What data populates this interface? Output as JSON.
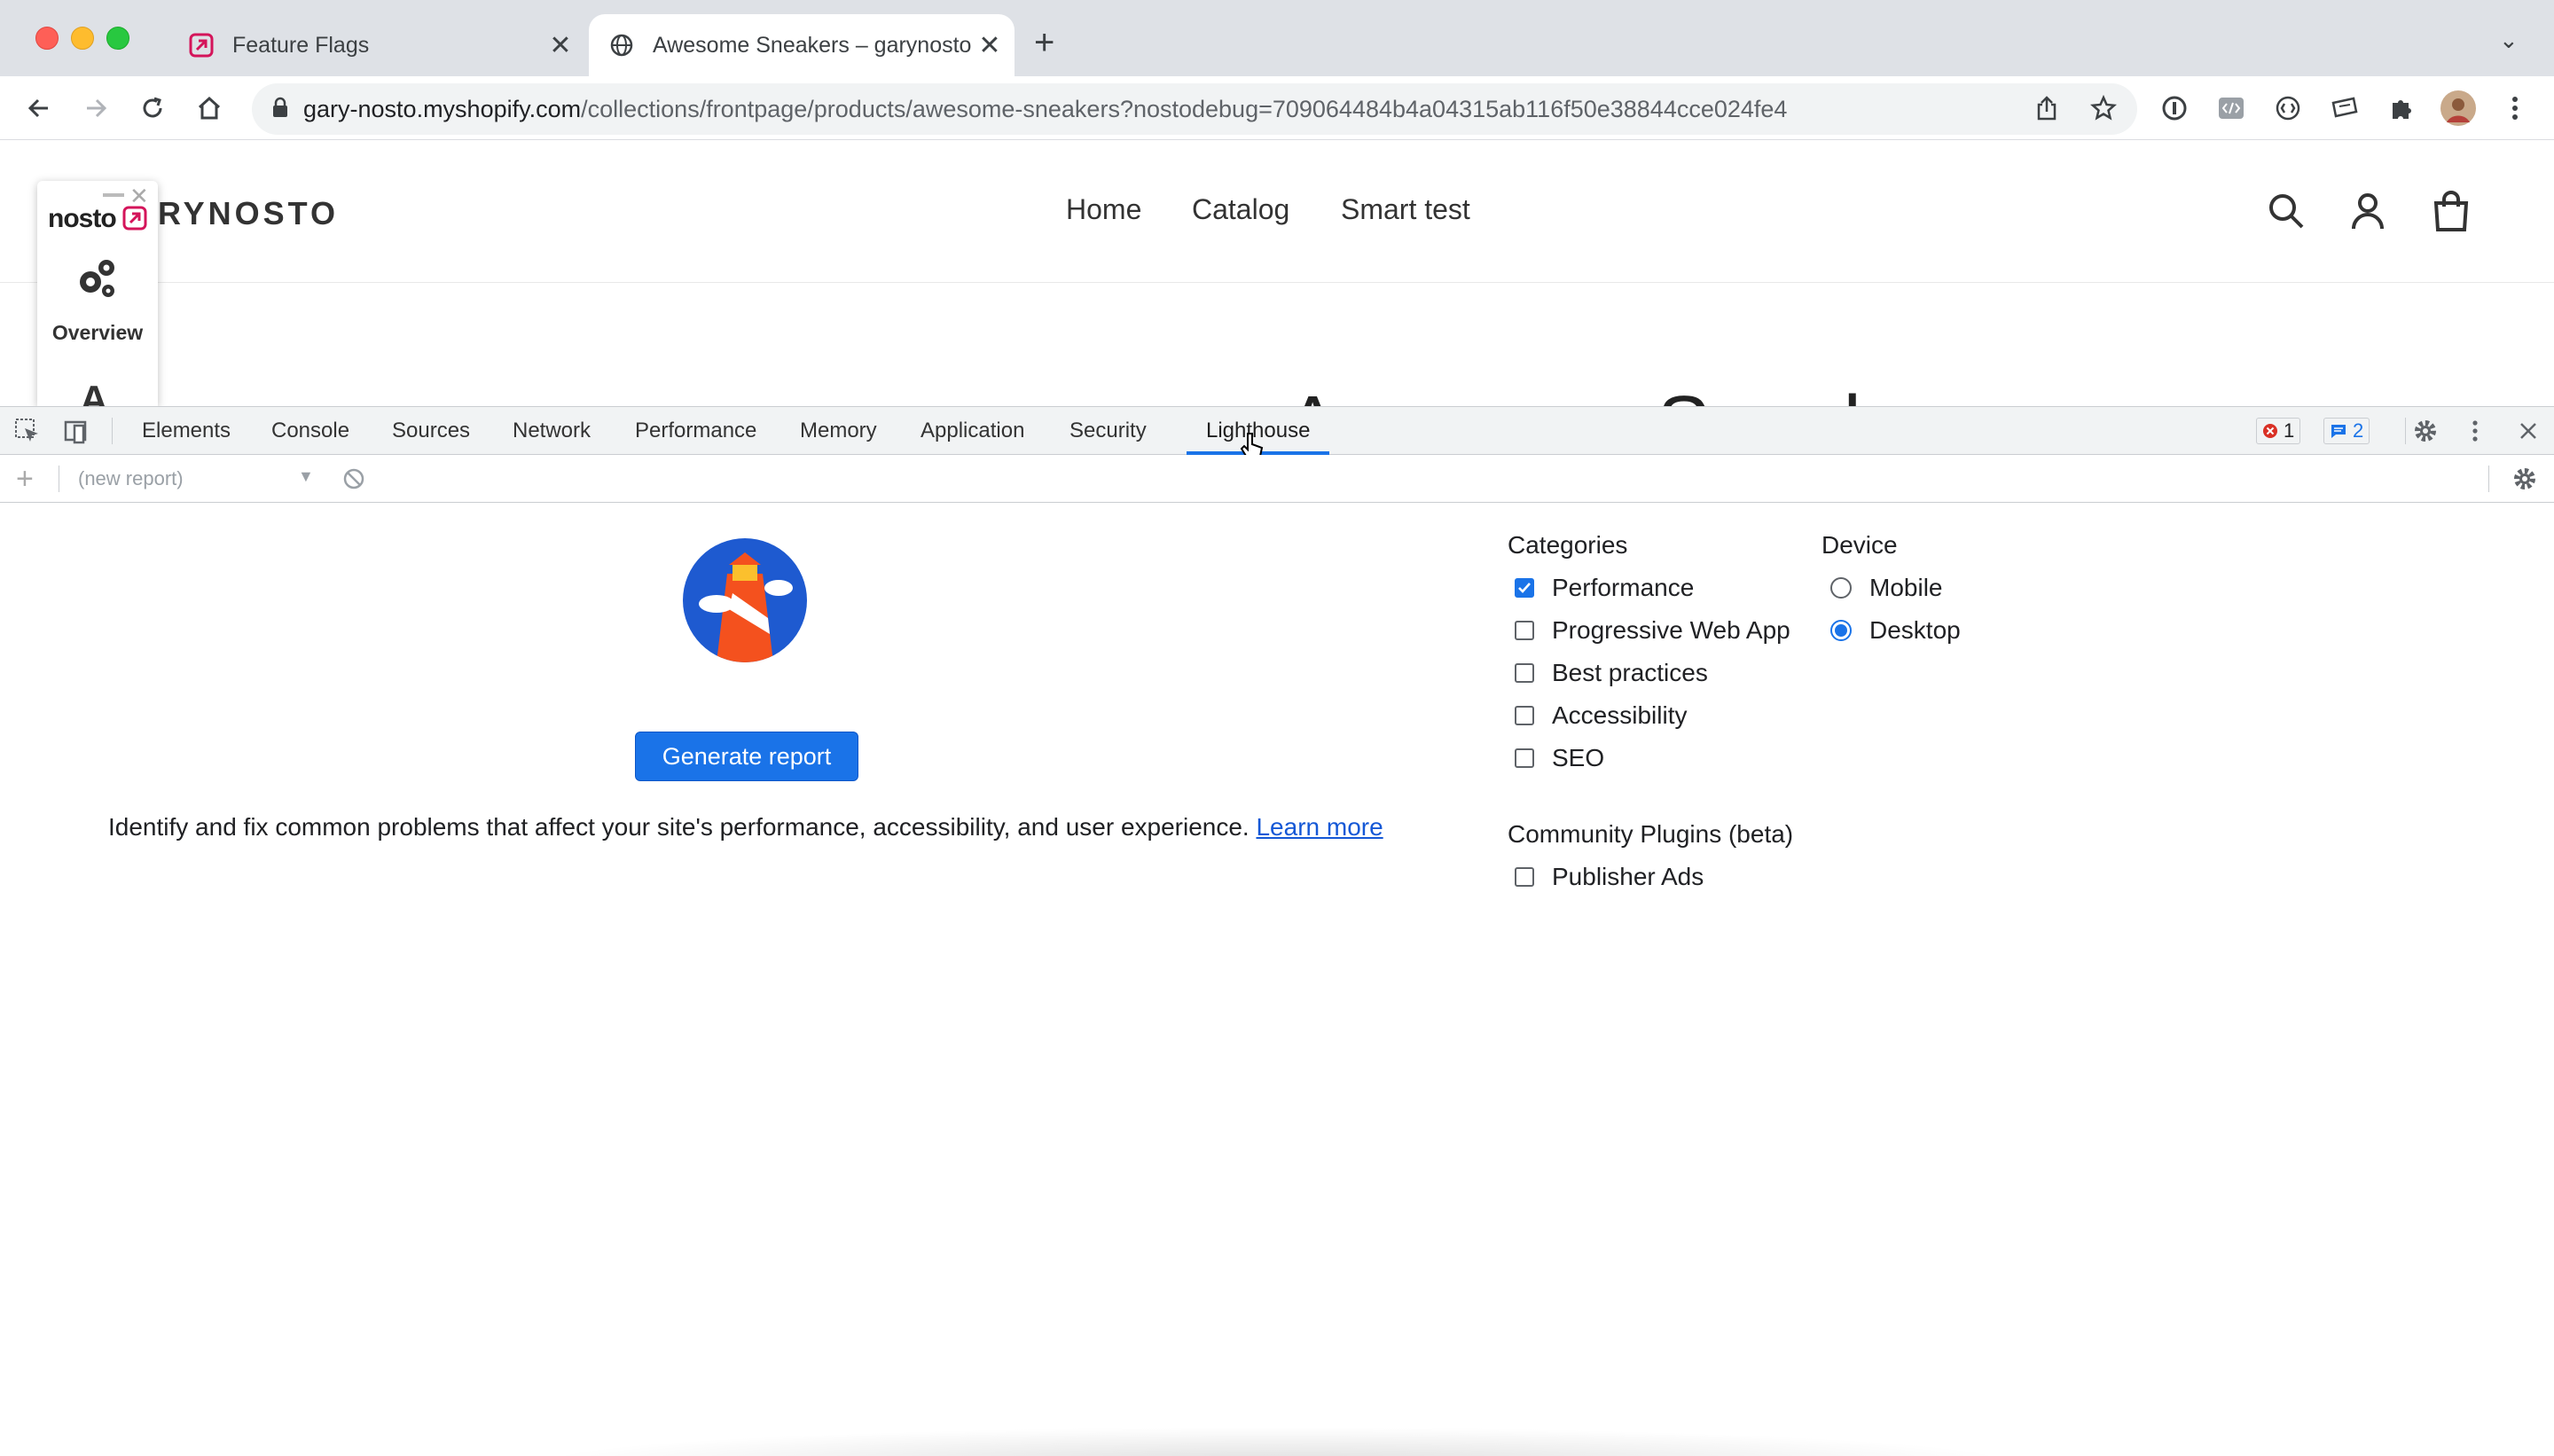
{
  "browser": {
    "tabs": [
      {
        "title": "Feature Flags",
        "favicon": "nosto-icon"
      },
      {
        "title": "Awesome Sneakers – garynosto",
        "favicon": "globe-icon"
      }
    ],
    "url_host": "gary-nosto.myshopify.com",
    "url_path": "/collections/frontpage/products/awesome-sneakers?nostodebug=709064484b4a04315ab116f50e38844cce024fe4"
  },
  "shop": {
    "logo": "RYNOSTO",
    "nav": [
      "Home",
      "Catalog",
      "Smart test"
    ],
    "product_title": "Awesome Sneakers"
  },
  "nosto": {
    "logo": "nosto",
    "overview_label": "Overview",
    "next_letter": "A"
  },
  "devtools": {
    "tabs": [
      "Elements",
      "Console",
      "Sources",
      "Network",
      "Performance",
      "Memory",
      "Application",
      "Security",
      "Lighthouse"
    ],
    "active_tab": "Lighthouse",
    "error_count": "1",
    "message_count": "2",
    "report_select": "(new report)"
  },
  "lighthouse": {
    "button": "Generate report",
    "description": "Identify and fix common problems that affect your site's performance, accessibility, and user experience.",
    "learn_more": "Learn more",
    "categories_title": "Categories",
    "categories": [
      {
        "label": "Performance",
        "checked": true
      },
      {
        "label": "Progressive Web App",
        "checked": false
      },
      {
        "label": "Best practices",
        "checked": false
      },
      {
        "label": "Accessibility",
        "checked": false
      },
      {
        "label": "SEO",
        "checked": false
      }
    ],
    "device_title": "Device",
    "devices": [
      {
        "label": "Mobile",
        "selected": false
      },
      {
        "label": "Desktop",
        "selected": true
      }
    ],
    "plugins_title": "Community Plugins (beta)",
    "plugins": [
      {
        "label": "Publisher Ads",
        "checked": false
      }
    ]
  },
  "colors": {
    "accent": "#1a73e8",
    "lighthouse_blue": "#1e5ad0",
    "lighthouse_red": "#f4511e",
    "nosto_pink": "#d4145a"
  }
}
